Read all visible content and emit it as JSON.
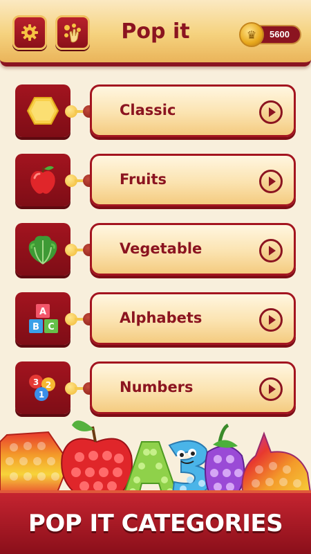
{
  "header": {
    "title": "Pop it",
    "settings_icon": "gear-icon",
    "hint_icon": "tap-hint-icon",
    "coins": "5600",
    "coin_icon": "crown-coin-icon"
  },
  "categories": [
    {
      "label": "Classic",
      "icon": "hexagon-icon"
    },
    {
      "label": "Fruits",
      "icon": "apple-icon"
    },
    {
      "label": "Vegetable",
      "icon": "lettuce-icon"
    },
    {
      "label": "Alphabets",
      "icon": "abc-blocks-icon"
    },
    {
      "label": "Numbers",
      "icon": "number-balloons-icon"
    }
  ],
  "footer": {
    "banner": "POP IT CATEGORIES"
  },
  "colors": {
    "brand_red": "#8b1420",
    "gold": "#f4c84e",
    "background": "#f8efdc"
  }
}
